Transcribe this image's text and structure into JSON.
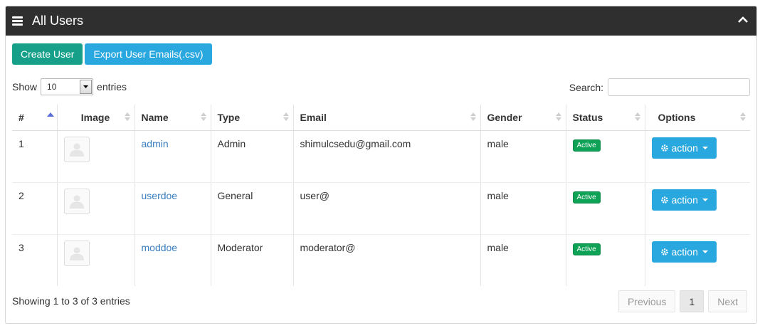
{
  "panel": {
    "title": "All Users"
  },
  "toolbar": {
    "create_label": "Create User",
    "export_label": "Export User Emails(.csv)"
  },
  "length": {
    "show_label": "Show",
    "selected": "10",
    "entries_label": "entries"
  },
  "search": {
    "label": "Search:",
    "value": ""
  },
  "table": {
    "headers": [
      "#",
      "Image",
      "Name",
      "Type",
      "Email",
      "Gender",
      "Status",
      "Options"
    ],
    "rows": [
      {
        "num": "1",
        "name": "admin",
        "type": "Admin",
        "email": "shimulcsedu@gmail.com",
        "gender": "male",
        "status": "Active",
        "action": "action"
      },
      {
        "num": "2",
        "name": "userdoe",
        "type": "General",
        "email": "user@",
        "gender": "male",
        "status": "Active",
        "action": "action"
      },
      {
        "num": "3",
        "name": "moddoe",
        "type": "Moderator",
        "email": "moderator@",
        "gender": "male",
        "status": "Active",
        "action": "action"
      }
    ]
  },
  "footer": {
    "info": "Showing 1 to 3 of 3 entries",
    "previous": "Previous",
    "page": "1",
    "next": "Next"
  },
  "colors": {
    "header_bg": "#2f2f2f",
    "green": "#16a08a",
    "blue": "#29a7df",
    "badge": "#0da255",
    "link": "#3a7ebf"
  },
  "icons": {
    "menu": "hamburger-icon",
    "collapse": "chevron-up-icon",
    "gear": "gear-icon",
    "avatar": "user-placeholder-icon"
  }
}
